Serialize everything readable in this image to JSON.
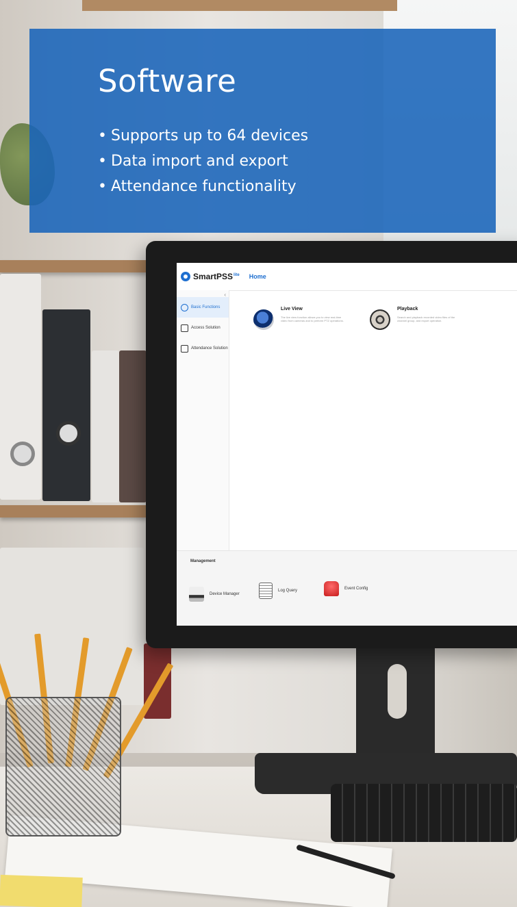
{
  "panel": {
    "title": "Software",
    "bullets": [
      "Supports up to 64 devices",
      "Data import and export",
      "Attendance functionality"
    ],
    "bullet_symbol": "•",
    "background_color": "#1964b9"
  },
  "app": {
    "logo": {
      "name": "SmartPSS",
      "superscript": "lite"
    },
    "header_tab": "Home",
    "sidebar_collapse": "‹",
    "sidebar_items": [
      {
        "label": "Basic Functions",
        "icon": "user-icon",
        "active": true
      },
      {
        "label": "Access Solution",
        "icon": "door-icon",
        "active": false
      },
      {
        "label": "Attendance Solution",
        "icon": "calendar-icon",
        "active": false
      }
    ],
    "cards": [
      {
        "title": "Live View",
        "description": "The live view function allows you to view real-time video from cameras and to perform PTZ operations.",
        "icon": "live-view-icon"
      },
      {
        "title": "Playback",
        "description": "Search and playback recorded video files of the channel group, and export operation.",
        "icon": "playback-icon"
      }
    ],
    "management": {
      "title": "Management",
      "items": [
        {
          "label": "Device Manager",
          "icon": "device-manager-icon"
        },
        {
          "label": "Log Query",
          "icon": "log-query-icon"
        },
        {
          "label": "Event Config",
          "icon": "event-config-icon"
        }
      ]
    },
    "accent_color": "#1e6fd0"
  }
}
